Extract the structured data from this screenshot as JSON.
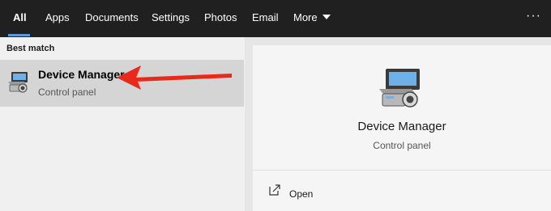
{
  "tabs": [
    {
      "label": "All",
      "active": true
    },
    {
      "label": "Apps"
    },
    {
      "label": "Documents"
    },
    {
      "label": "Settings"
    },
    {
      "label": "Photos"
    },
    {
      "label": "Email"
    },
    {
      "label": "More"
    }
  ],
  "more_icon": "caret-down-icon",
  "overflow_icon": "ellipsis-icon",
  "overflow_label": "···",
  "results": {
    "section_header": "Best match",
    "best_match": {
      "title": "Device Manager",
      "subtitle": "Control panel",
      "icon": "device-manager-icon",
      "annotation": "red-arrow"
    }
  },
  "preview": {
    "title": "Device Manager",
    "subtitle": "Control panel",
    "icon": "device-manager-icon",
    "actions": [
      {
        "label": "Open",
        "icon": "open-icon"
      }
    ]
  },
  "colors": {
    "topbar_bg": "#202020",
    "accent_underline": "#5b9bd5",
    "selected_item_bg": "#d5d5d5",
    "annotation_arrow": "#e8291c"
  }
}
